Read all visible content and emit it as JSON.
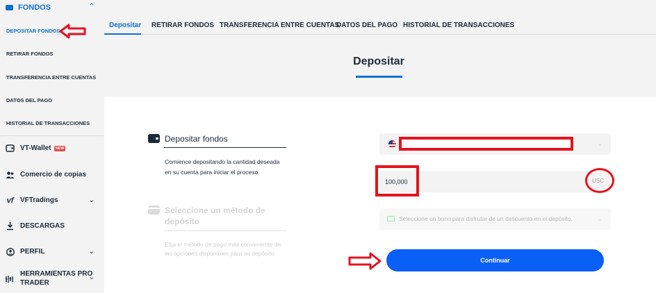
{
  "sidebar": {
    "section": {
      "label": "FONDOS"
    },
    "sub_items": [
      {
        "label": "DEPOSITAR FONDOS",
        "active": true
      },
      {
        "label": "RETIRAR FONDOS"
      },
      {
        "label": "TRANSFERENCIA ENTRE CUENTAS"
      },
      {
        "label": "DATOS DEL PAGO"
      },
      {
        "label": "HISTORIAL DE TRANSACCIONES"
      }
    ],
    "nav_items": [
      {
        "label": "VT-Wallet",
        "badge": "NEW",
        "icon": "wallet-icon"
      },
      {
        "label": "Comercio de copias",
        "icon": "people-icon"
      },
      {
        "label": "VFTradings",
        "icon": "vf-logo-icon"
      },
      {
        "label": "DESCARGAS",
        "icon": "download-icon"
      },
      {
        "label": "PERFIL",
        "icon": "user-icon"
      },
      {
        "label": "HERRAMIENTAS PRO",
        "label2": "TRADER",
        "icon": "tools-icon"
      }
    ]
  },
  "tabs": [
    {
      "label": "Depositar",
      "active": true
    },
    {
      "label": "RETIRAR FONDOS"
    },
    {
      "label": "TRANSFERENCIA ENTRE CUENTAS"
    },
    {
      "label": "DATOS DEL PAGO"
    },
    {
      "label": "HISTORIAL DE TRANSACCIONES"
    }
  ],
  "page": {
    "title": "Depositar"
  },
  "steps": {
    "step1": {
      "title": "Depositar fondos",
      "description": "Comience depositando la cantidad deseada en su cuenta para iniciar el proceso."
    },
    "step2": {
      "title": "Seleccione un método de depósito",
      "description": "Elija el método de pago más conveniente de las opciones disponibles para su depósito."
    }
  },
  "form": {
    "account": {
      "value": ""
    },
    "amount": {
      "value": "100,000",
      "currency": "USC"
    },
    "bonus": {
      "placeholder": "Seleccione un bono para disfrutar de un descuento en el depósito."
    },
    "continue_label": "Continuar"
  },
  "colors": {
    "accent": "#0f6fd6",
    "button": "#0a5ff6",
    "annotation": "#e4121f"
  }
}
